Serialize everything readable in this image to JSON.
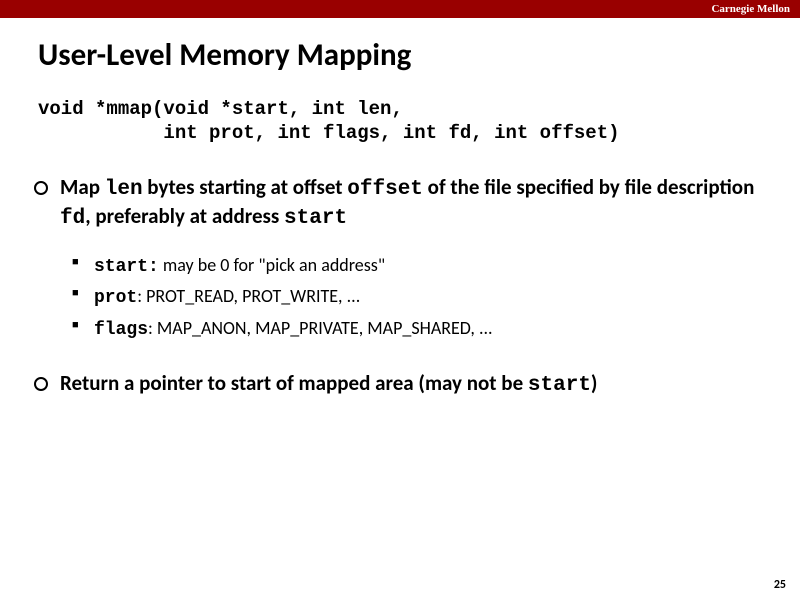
{
  "brand": "Carnegie Mellon",
  "title": "User-Level Memory Mapping",
  "code_line1": "void *mmap(void *start, int len,",
  "code_line2": "           int prot, int flags, int fd, int offset)",
  "bullet1_prefix": "Map ",
  "bullet1_len": "len",
  "bullet1_mid1": " bytes starting at offset ",
  "bullet1_offset": "offset",
  "bullet1_mid2": "  of the file specified by file description ",
  "bullet1_fd": "fd",
  "bullet1_mid3": ", preferably at address ",
  "bullet1_start": "start",
  "sub1_code": "start:",
  "sub1_text": " may be 0 for \"pick an address\"",
  "sub2_code": "prot",
  "sub2_text": ": PROT_READ, PROT_WRITE, ...",
  "sub3_code": "flags",
  "sub3_text": ": MAP_ANON, MAP_PRIVATE, MAP_SHARED, ...",
  "bullet2_text": "Return a pointer to start of mapped area (may not be ",
  "bullet2_code": "start",
  "bullet2_tail": ")",
  "page_number": "25"
}
